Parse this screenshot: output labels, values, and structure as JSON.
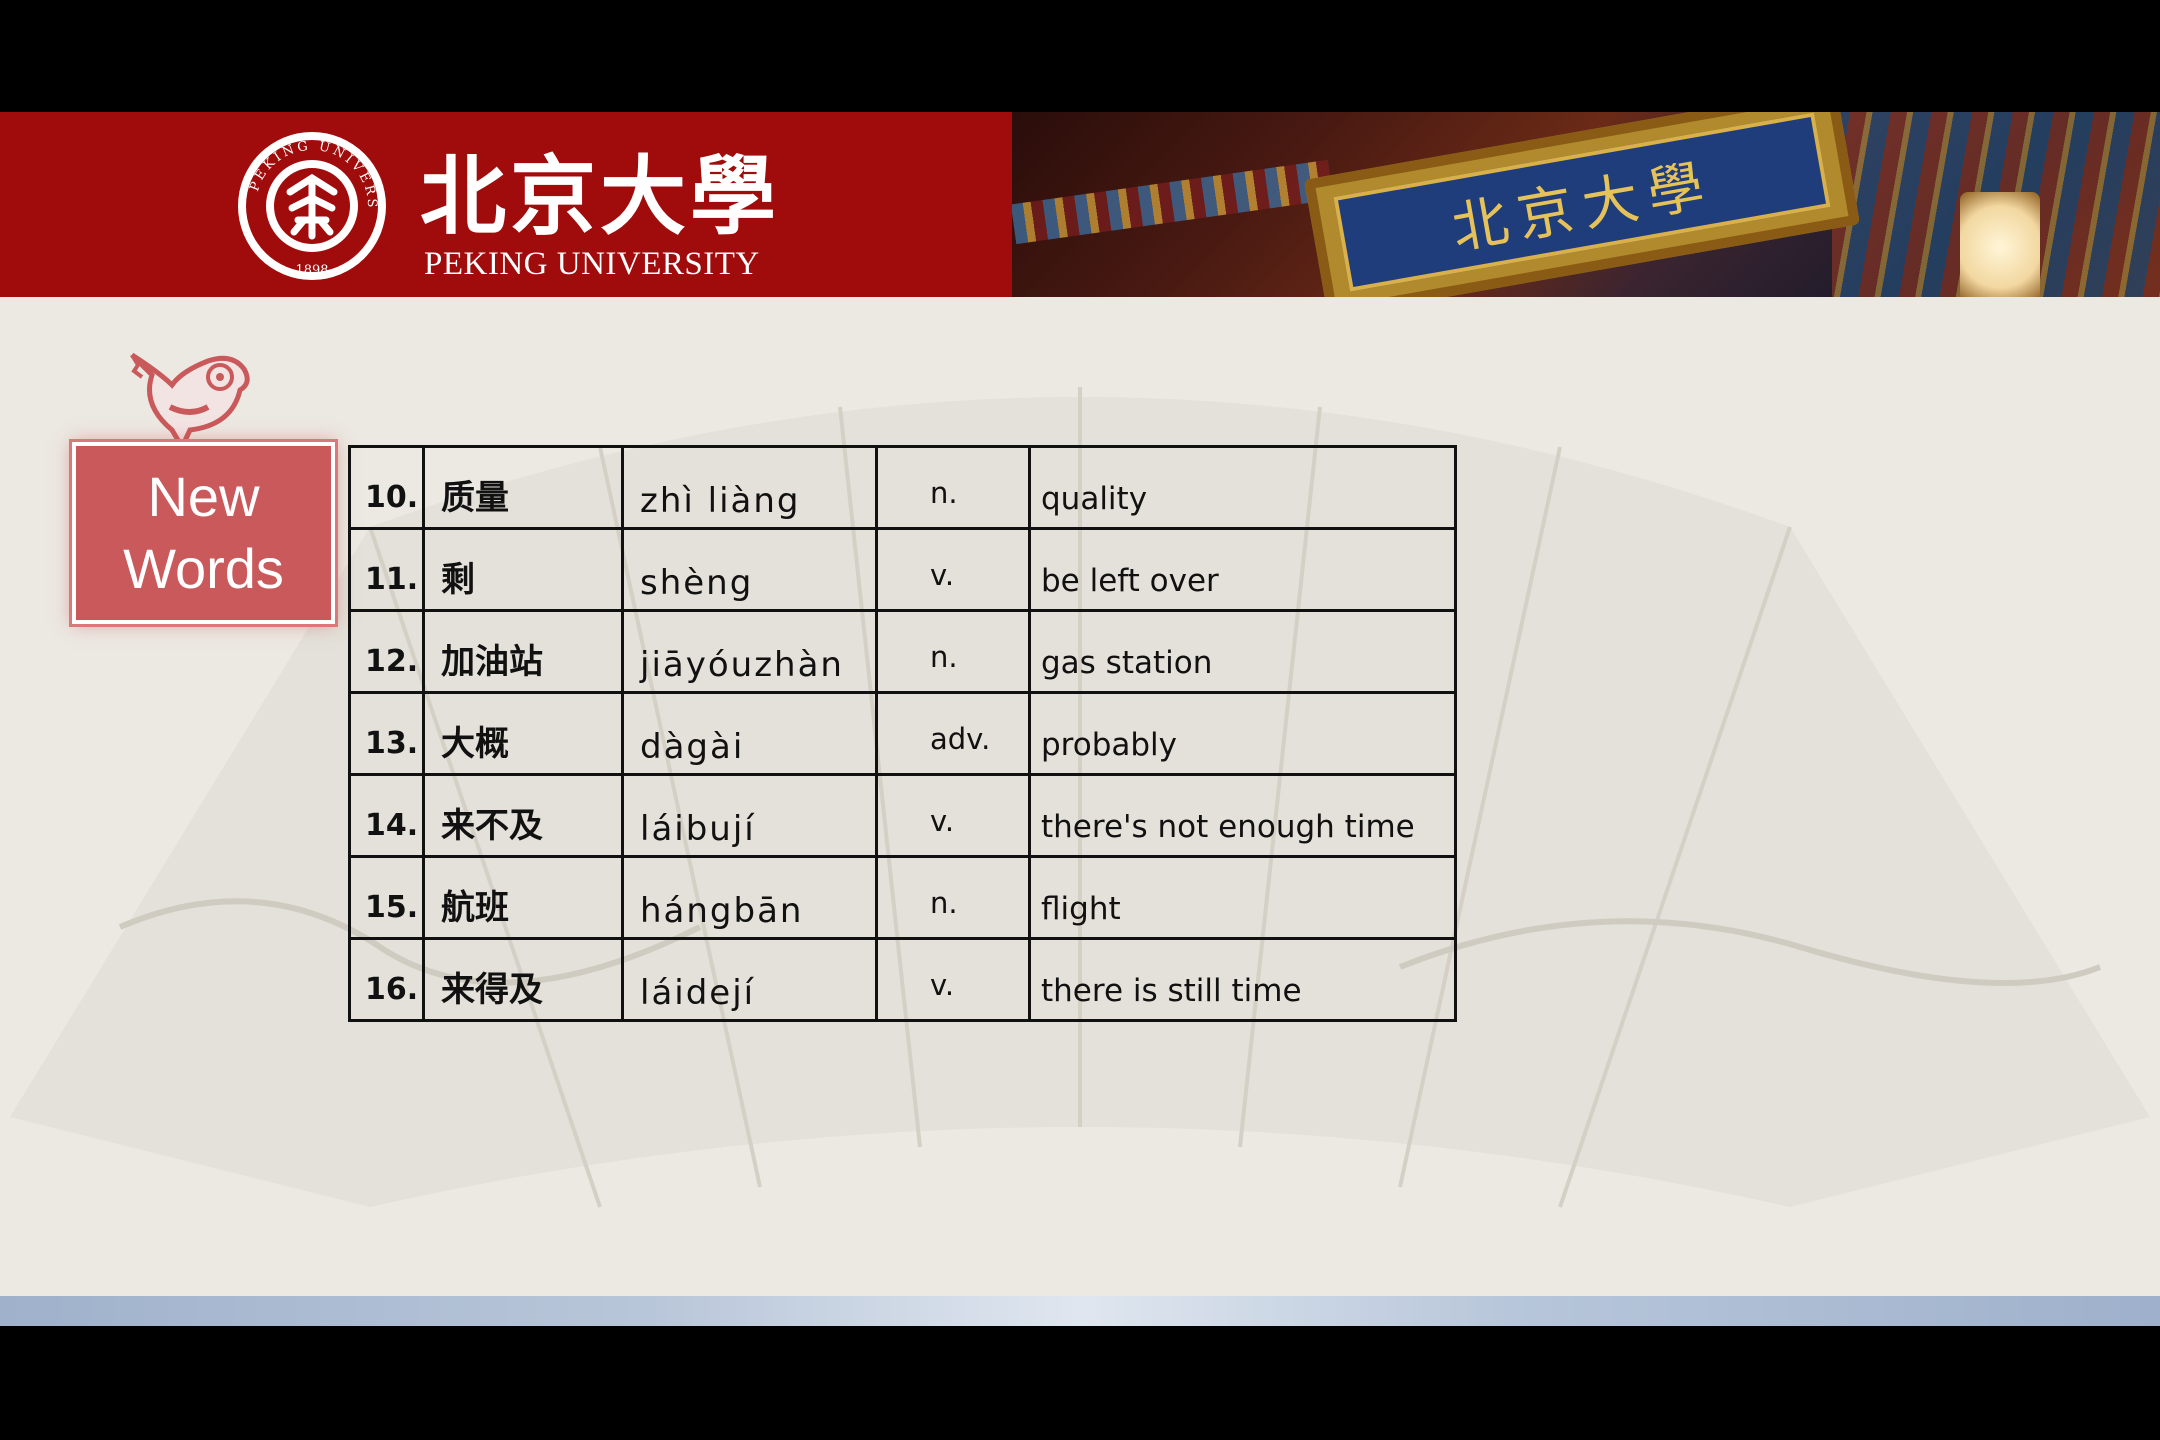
{
  "header": {
    "logo_cn": "北京大學",
    "logo_en": "PEKING UNIVERSITY",
    "plaque_text": "北京大學"
  },
  "badge": {
    "line1": "New",
    "line2": "Words"
  },
  "vocab": [
    {
      "num": "10.",
      "hanzi": "质量",
      "pinyin": "zhì liàng",
      "pos": "n.",
      "english": "quality"
    },
    {
      "num": "11.",
      "hanzi": "剩",
      "pinyin": "shèng",
      "pos": "v.",
      "english": "be left over"
    },
    {
      "num": "12.",
      "hanzi": "加油站",
      "pinyin": "jiāyóuzhàn",
      "pos": "n.",
      "english": "gas station"
    },
    {
      "num": "13.",
      "hanzi": "大概",
      "pinyin": "dàgài",
      "pos": "adv.",
      "english": "probably"
    },
    {
      "num": "14.",
      "hanzi": "来不及",
      "pinyin": "láibují",
      "pos": "v.",
      "english": "there's not enough time"
    },
    {
      "num": "15.",
      "hanzi": "航班",
      "pinyin": "hángbān",
      "pos": "n.",
      "english": "flight"
    },
    {
      "num": "16.",
      "hanzi": "来得及",
      "pinyin": "láidejí",
      "pos": "v.",
      "english": "there is still time"
    }
  ],
  "colors": {
    "brand_red": "#a00b0b",
    "badge_red": "#c9595b",
    "slide_bg": "#ece9e2"
  }
}
